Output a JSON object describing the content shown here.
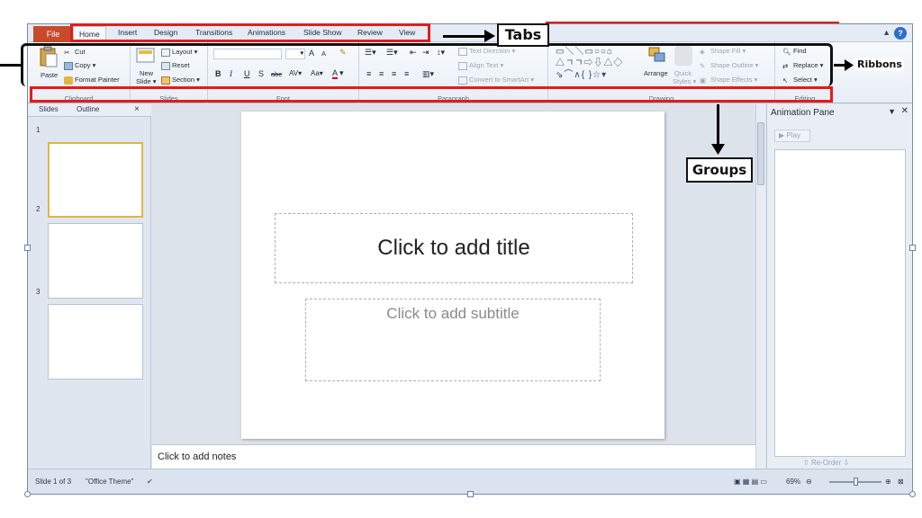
{
  "tabs": {
    "file": "File",
    "items": [
      "Home",
      "Insert",
      "Design",
      "Transitions",
      "Animations",
      "Slide Show",
      "Review",
      "View"
    ],
    "active": "Home"
  },
  "ribbon": {
    "clipboard": {
      "paste": "Paste",
      "cut": "Cut",
      "copy": "Copy",
      "format_painter": "Format Painter",
      "label": "Clipboard"
    },
    "slides": {
      "new_slide": "New",
      "new_slide_2": "Slide",
      "layout": "Layout",
      "reset": "Reset",
      "section": "Section",
      "label": "Slides"
    },
    "font": {
      "grow": "A",
      "shrink": "A",
      "bold": "B",
      "italic": "I",
      "underline": "U",
      "shadow": "S",
      "strike": "abc",
      "spacing": "AV",
      "case": "Aa",
      "color": "A",
      "label": "Font"
    },
    "paragraph": {
      "text_direction": "Text Direction",
      "align_text": "Align Text",
      "convert_smartart": "Convert to SmartArt",
      "label": "Paragraph"
    },
    "drawing": {
      "arrange": "Arrange",
      "quick_styles": "Quick",
      "quick_styles_2": "Styles",
      "shape_fill": "Shape Fill",
      "shape_outline": "Shape Outline",
      "shape_effects": "Shape Effects",
      "label": "Drawing"
    },
    "editing": {
      "find": "Find",
      "replace": "Replace",
      "select": "Select",
      "label": "Editing"
    }
  },
  "panel": {
    "tab_slides": "Slides",
    "tab_outline": "Outline",
    "close": "×",
    "thumbs": [
      "1",
      "2",
      "3"
    ]
  },
  "slide": {
    "title": "Click to add title",
    "subtitle": "Click to add subtitle"
  },
  "notes": "Click to add notes",
  "animation_pane": {
    "title": "Animation Pane",
    "play": "Play",
    "reorder": "Re-Order"
  },
  "status": {
    "slide_count": "Slide 1 of 3",
    "theme": "\"Office Theme\"",
    "zoom": "69%"
  },
  "annotations": {
    "tabs": "Tabs",
    "ribbons": "Ribbons",
    "groups": "Groups"
  },
  "colors": {
    "annotation_red": "#e41b1b",
    "file_tab": "#c74a2a",
    "thumb_selected": "#e0b64b"
  }
}
